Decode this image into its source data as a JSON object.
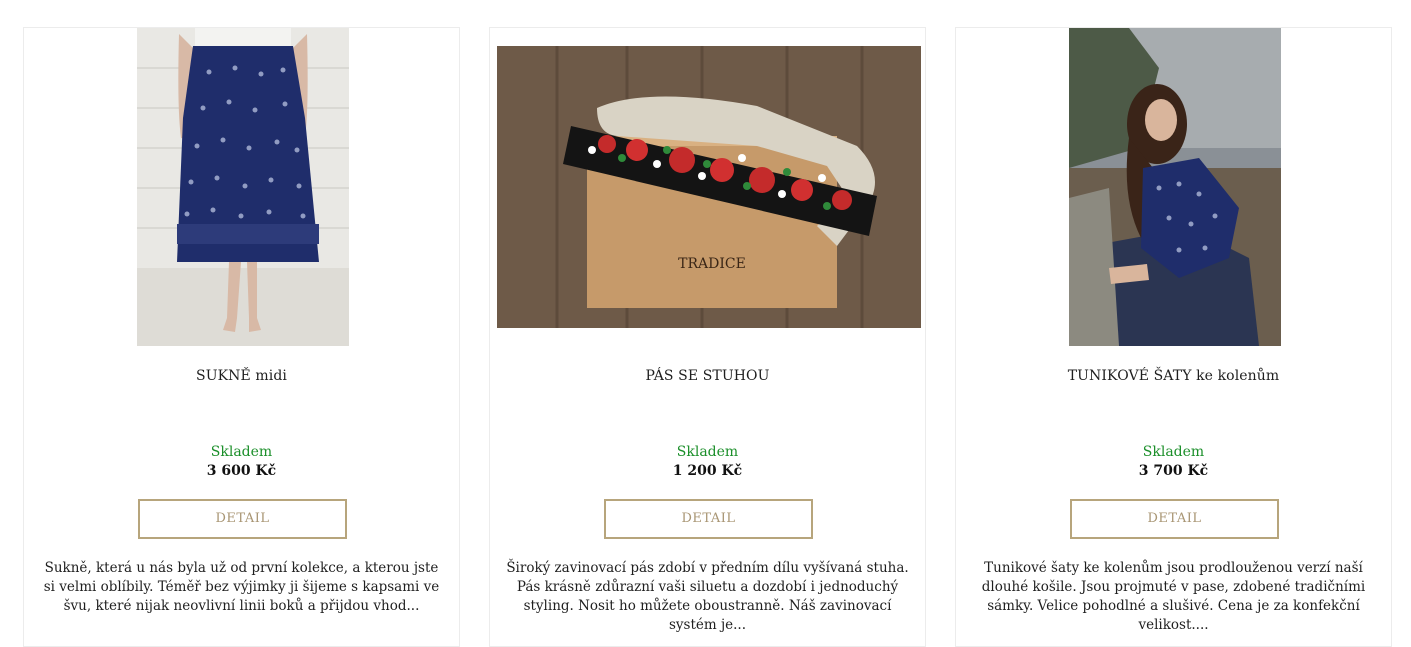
{
  "products": [
    {
      "title": "SUKNĚ midi",
      "stock": "Skladem",
      "price": "3 600 Kč",
      "button": "DETAIL",
      "description": "Sukně, která u nás byla už od první kolekce, a kterou jste si velmi oblíbily. Téměř bez výjimky ji šijeme s kapsami ve švu, které nijak neovlivní linii boků a přijdou vhod...",
      "image_icon": "skirt-photo"
    },
    {
      "title": "PÁS SE STUHOU",
      "stock": "Skladem",
      "price": "1 200 Kč",
      "button": "DETAIL",
      "description": "Široký zavinovací pás zdobí v předním dílu vyšívaná stuha. Pás krásně zdůrazní vaši siluetu a dozdobí i jednoduchý styling. Nosit ho můžete oboustranně. Náš zavinovací systém je...",
      "image_icon": "belt-photo",
      "box_label": "TRADICE"
    },
    {
      "title": "TUNIKOVÉ ŠATY ke kolenům",
      "stock": "Skladem",
      "price": "3 700 Kč",
      "button": "DETAIL",
      "description": "Tunikové šaty ke kolenům jsou prodlouženou verzí naší dlouhé košile. Jsou projmuté v pase, zdobené tradičními sámky. Velice pohodlné a slušivé. Cena je za konfekční velikost....",
      "image_icon": "dress-photo"
    }
  ],
  "colors": {
    "stock": "#1b8f2a",
    "button_border": "#b7a57c",
    "button_text": "#a89573",
    "indigo": "#1f2d6b"
  }
}
